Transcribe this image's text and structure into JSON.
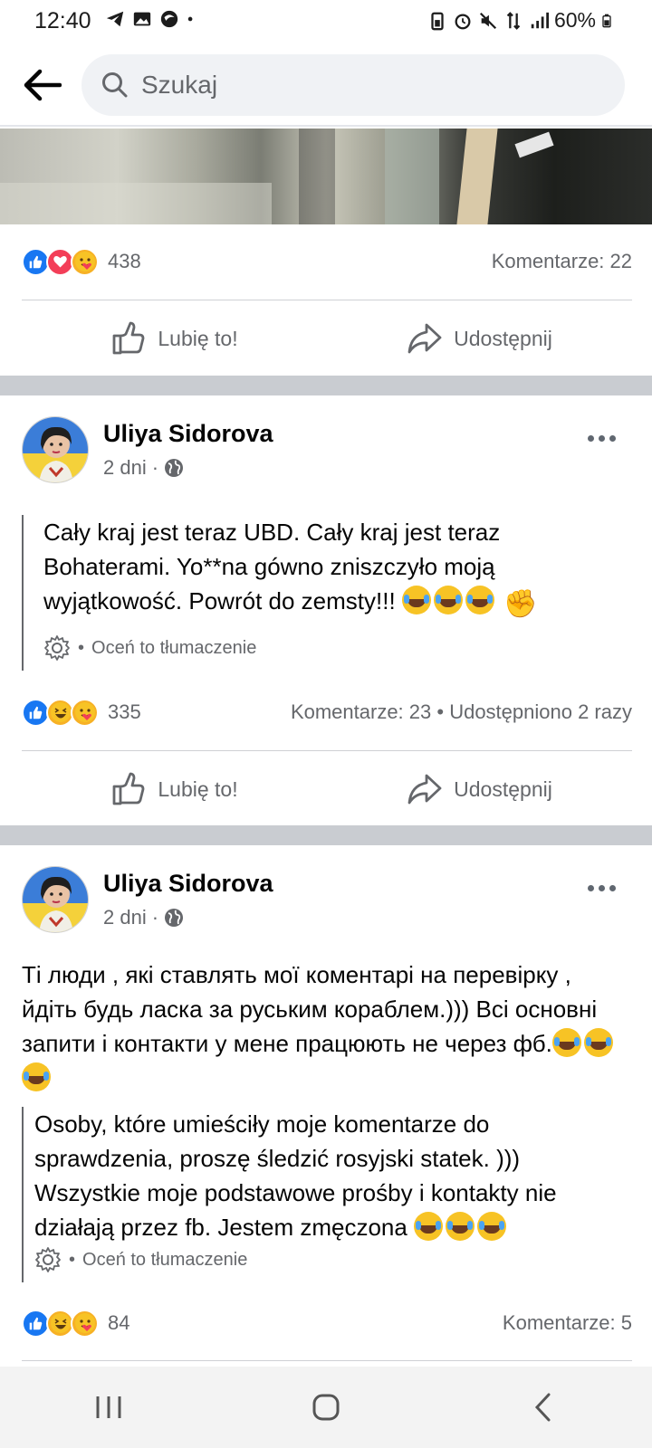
{
  "status_bar": {
    "time": "12:40",
    "battery": "60%",
    "left_icons": [
      "telegram-icon",
      "gallery-icon",
      "app-icon",
      "dot-icon"
    ],
    "right_icons": [
      "battery-saver-icon",
      "alarm-icon",
      "mute-icon",
      "data-icon",
      "signal-icon",
      "battery-icon"
    ]
  },
  "search": {
    "placeholder": "Szukaj"
  },
  "posts": [
    {
      "reaction_count": "438",
      "comments": "Komentarze: 22",
      "like_label": "Lubię to!",
      "share_label": "Udostępnij"
    },
    {
      "author": "Uliya Sidorova",
      "time": "2 dni",
      "dot": "·",
      "text": "Cały kraj jest teraz UBD. Cały kraj jest teraz Bohaterami. Yo**na gówno zniszczyło moją wyjątkowość. Powrót do zemsty!!!",
      "translate_dot": "•",
      "translate_label": "Oceń to tłumaczenie",
      "reaction_count": "335",
      "comments": "Komentarze: 23",
      "meta_dot": "•",
      "shares": "Udostępniono 2 razy",
      "like_label": "Lubię to!",
      "share_label": "Udostępnij"
    },
    {
      "author": "Uliya Sidorova",
      "time": "2 dni",
      "dot": "·",
      "original_text": "Ті люди , які ставлять мої коментарі на перевірку , йдіть будь ласка за руським кораблем.))) Всі основні запити і контакти у мене працюють не через фб.",
      "text": "Osoby, które umieściły moje komentarze do sprawdzenia, proszę śledzić rosyjski statek. ))) Wszystkie moje podstawowe prośby i kontakty nie działają przez fb. Jestem zmęczona",
      "translate_dot": "•",
      "translate_label": "Oceń to tłumaczenie",
      "reaction_count": "84",
      "comments": "Komentarze: 5"
    }
  ],
  "colors": {
    "facebook_blue": "#1877f2",
    "love_red": "#f33e58",
    "secondary_text": "#65676b",
    "divider": "#c9ccd1"
  }
}
